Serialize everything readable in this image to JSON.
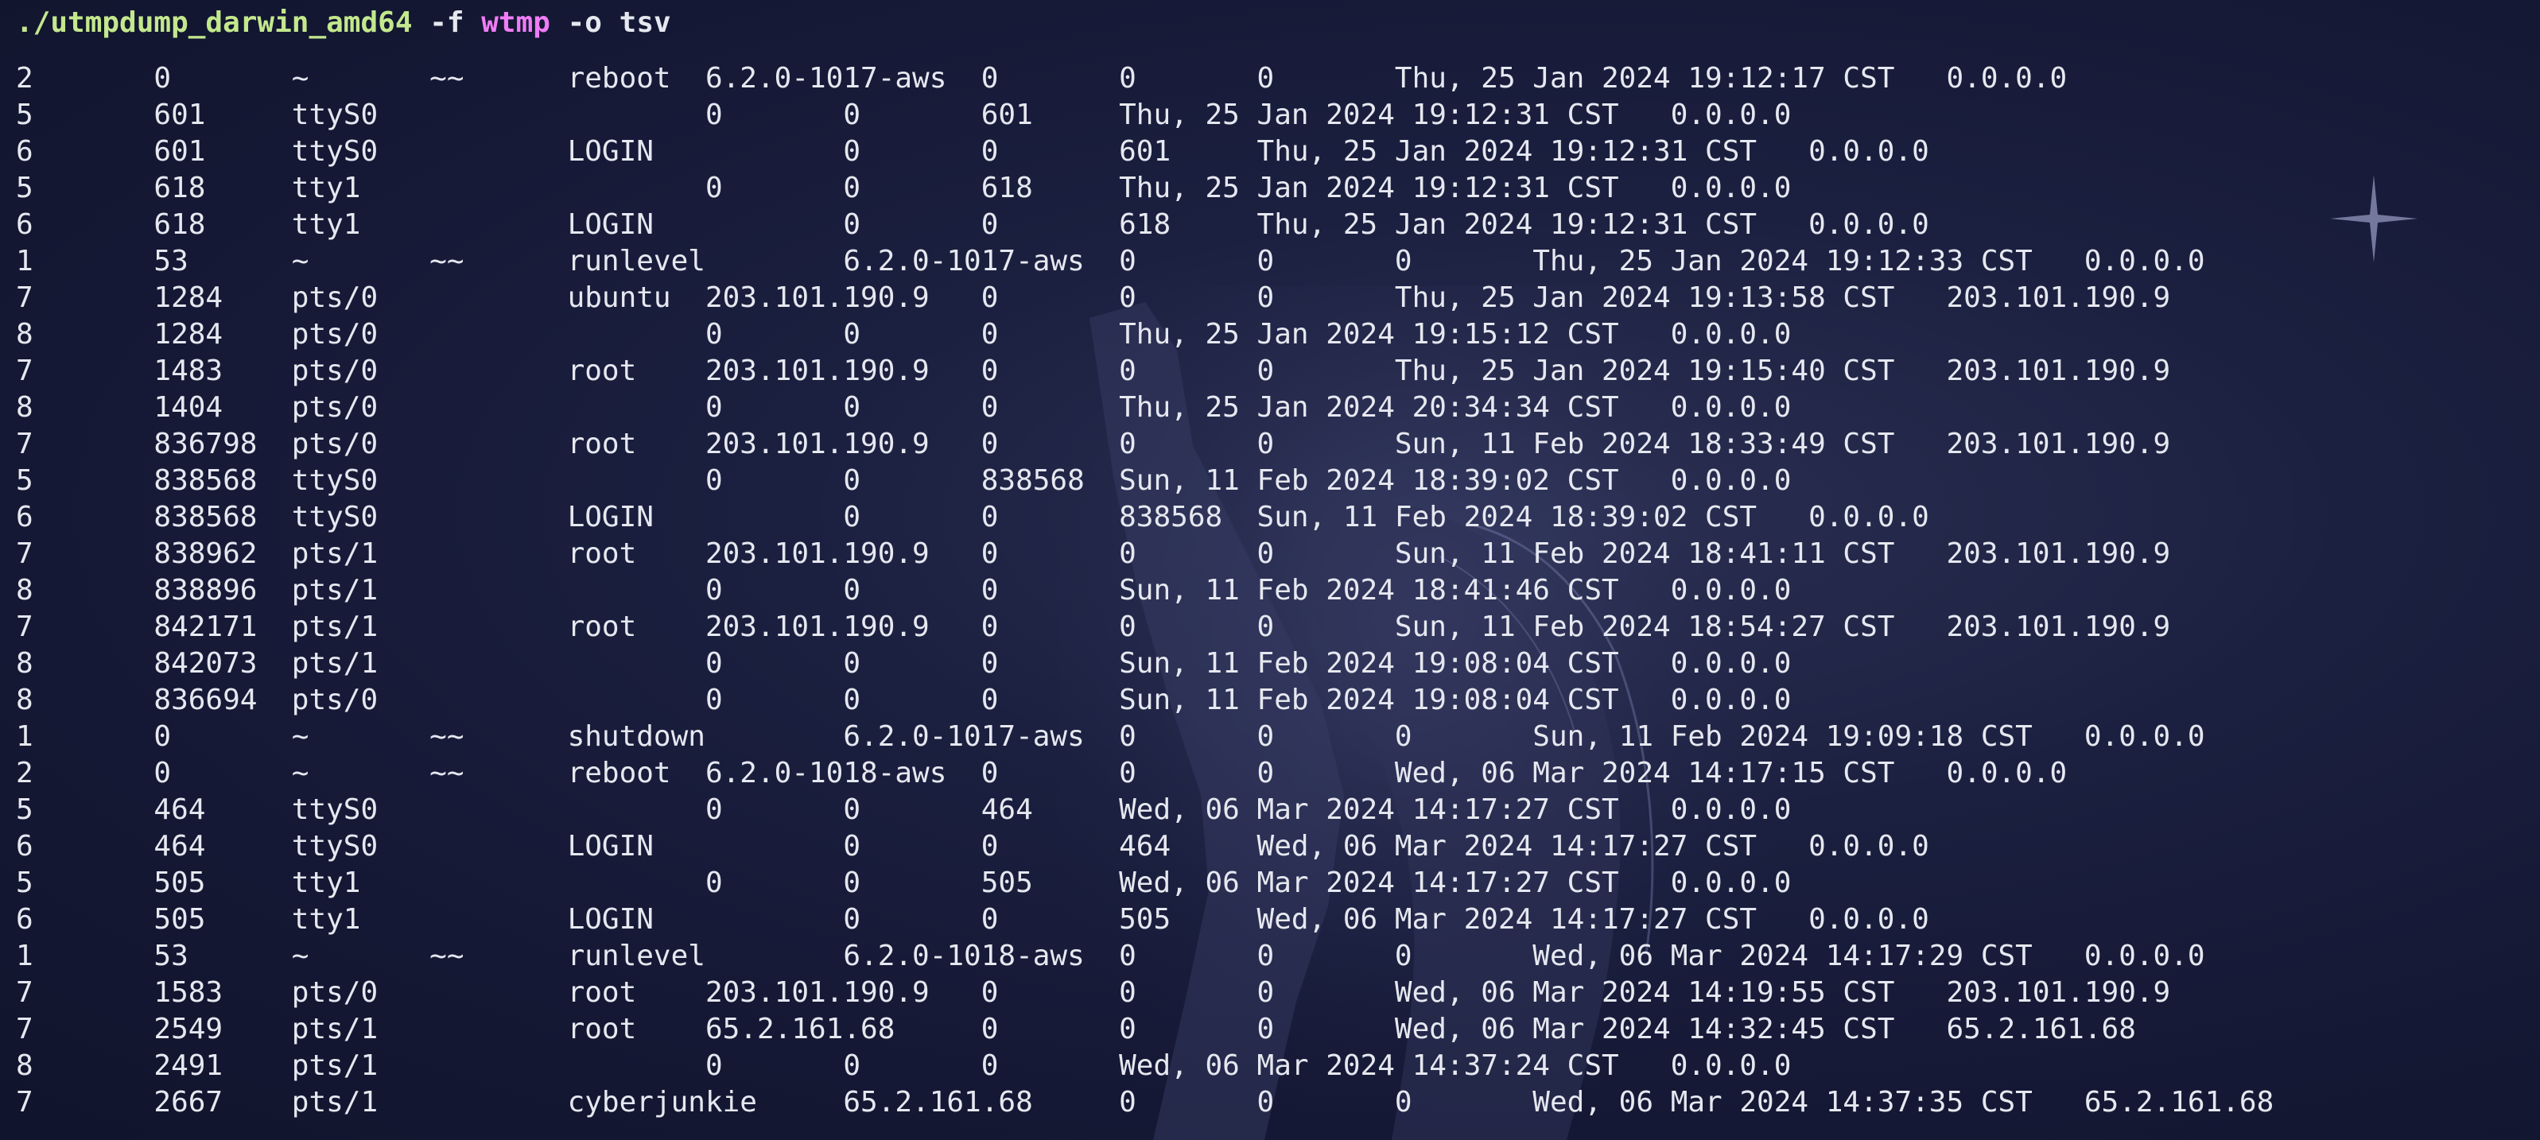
{
  "prompt": {
    "command": "./utmpdump_darwin_amd64",
    "flag_format": "-f",
    "arg_format": "wtmp",
    "flag_output": "-o",
    "arg_output": "tsv"
  },
  "colors": {
    "background": "#161a36",
    "text": "#e6e8f0",
    "command": "#c3e88d",
    "argument": "#f07cf6"
  },
  "rows": [
    "2\t0\t~\t~~\treboot\t6.2.0-1017-aws\t0\t0\t0\tThu, 25 Jan 2024 19:12:17 CST\t0.0.0.0",
    "5\t601\tttyS0\t\t\t0\t0\t601\tThu, 25 Jan 2024 19:12:31 CST\t0.0.0.0",
    "6\t601\tttyS0\t\tLOGIN\t\t0\t0\t601\tThu, 25 Jan 2024 19:12:31 CST\t0.0.0.0",
    "5\t618\ttty1\t\t\t0\t0\t618\tThu, 25 Jan 2024 19:12:31 CST\t0.0.0.0",
    "6\t618\ttty1\t\tLOGIN\t\t0\t0\t618\tThu, 25 Jan 2024 19:12:31 CST\t0.0.0.0",
    "1\t53\t~\t~~\trunlevel\t6.2.0-1017-aws\t0\t0\t0\tThu, 25 Jan 2024 19:12:33 CST\t0.0.0.0",
    "7\t1284\tpts/0\t\tubuntu\t203.101.190.9\t0\t0\t0\tThu, 25 Jan 2024 19:13:58 CST\t203.101.190.9",
    "8\t1284\tpts/0\t\t\t0\t0\t0\tThu, 25 Jan 2024 19:15:12 CST\t0.0.0.0",
    "7\t1483\tpts/0\t\troot\t203.101.190.9\t0\t0\t0\tThu, 25 Jan 2024 19:15:40 CST\t203.101.190.9",
    "8\t1404\tpts/0\t\t\t0\t0\t0\tThu, 25 Jan 2024 20:34:34 CST\t0.0.0.0",
    "7\t836798\tpts/0\t\troot\t203.101.190.9\t0\t0\t0\tSun, 11 Feb 2024 18:33:49 CST\t203.101.190.9",
    "5\t838568\tttyS0\t\t\t0\t0\t838568\tSun, 11 Feb 2024 18:39:02 CST\t0.0.0.0",
    "6\t838568\tttyS0\t\tLOGIN\t\t0\t0\t838568\tSun, 11 Feb 2024 18:39:02 CST\t0.0.0.0",
    "7\t838962\tpts/1\t\troot\t203.101.190.9\t0\t0\t0\tSun, 11 Feb 2024 18:41:11 CST\t203.101.190.9",
    "8\t838896\tpts/1\t\t\t0\t0\t0\tSun, 11 Feb 2024 18:41:46 CST\t0.0.0.0",
    "7\t842171\tpts/1\t\troot\t203.101.190.9\t0\t0\t0\tSun, 11 Feb 2024 18:54:27 CST\t203.101.190.9",
    "8\t842073\tpts/1\t\t\t0\t0\t0\tSun, 11 Feb 2024 19:08:04 CST\t0.0.0.0",
    "8\t836694\tpts/0\t\t\t0\t0\t0\tSun, 11 Feb 2024 19:08:04 CST\t0.0.0.0",
    "1\t0\t~\t~~\tshutdown\t6.2.0-1017-aws\t0\t0\t0\tSun, 11 Feb 2024 19:09:18 CST\t0.0.0.0",
    "2\t0\t~\t~~\treboot\t6.2.0-1018-aws\t0\t0\t0\tWed, 06 Mar 2024 14:17:15 CST\t0.0.0.0",
    "5\t464\tttyS0\t\t\t0\t0\t464\tWed, 06 Mar 2024 14:17:27 CST\t0.0.0.0",
    "6\t464\tttyS0\t\tLOGIN\t\t0\t0\t464\tWed, 06 Mar 2024 14:17:27 CST\t0.0.0.0",
    "5\t505\ttty1\t\t\t0\t0\t505\tWed, 06 Mar 2024 14:17:27 CST\t0.0.0.0",
    "6\t505\ttty1\t\tLOGIN\t\t0\t0\t505\tWed, 06 Mar 2024 14:17:27 CST\t0.0.0.0",
    "1\t53\t~\t~~\trunlevel\t6.2.0-1018-aws\t0\t0\t0\tWed, 06 Mar 2024 14:17:29 CST\t0.0.0.0",
    "7\t1583\tpts/0\t\troot\t203.101.190.9\t0\t0\t0\tWed, 06 Mar 2024 14:19:55 CST\t203.101.190.9",
    "7\t2549\tpts/1\t\troot\t65.2.161.68\t0\t0\t0\tWed, 06 Mar 2024 14:32:45 CST\t65.2.161.68",
    "8\t2491\tpts/1\t\t\t0\t0\t0\tWed, 06 Mar 2024 14:37:24 CST\t0.0.0.0",
    "7\t2667\tpts/1\t\tcyberjunkie\t65.2.161.68\t0\t0\t0\tWed, 06 Mar 2024 14:37:35 CST\t65.2.161.68"
  ]
}
